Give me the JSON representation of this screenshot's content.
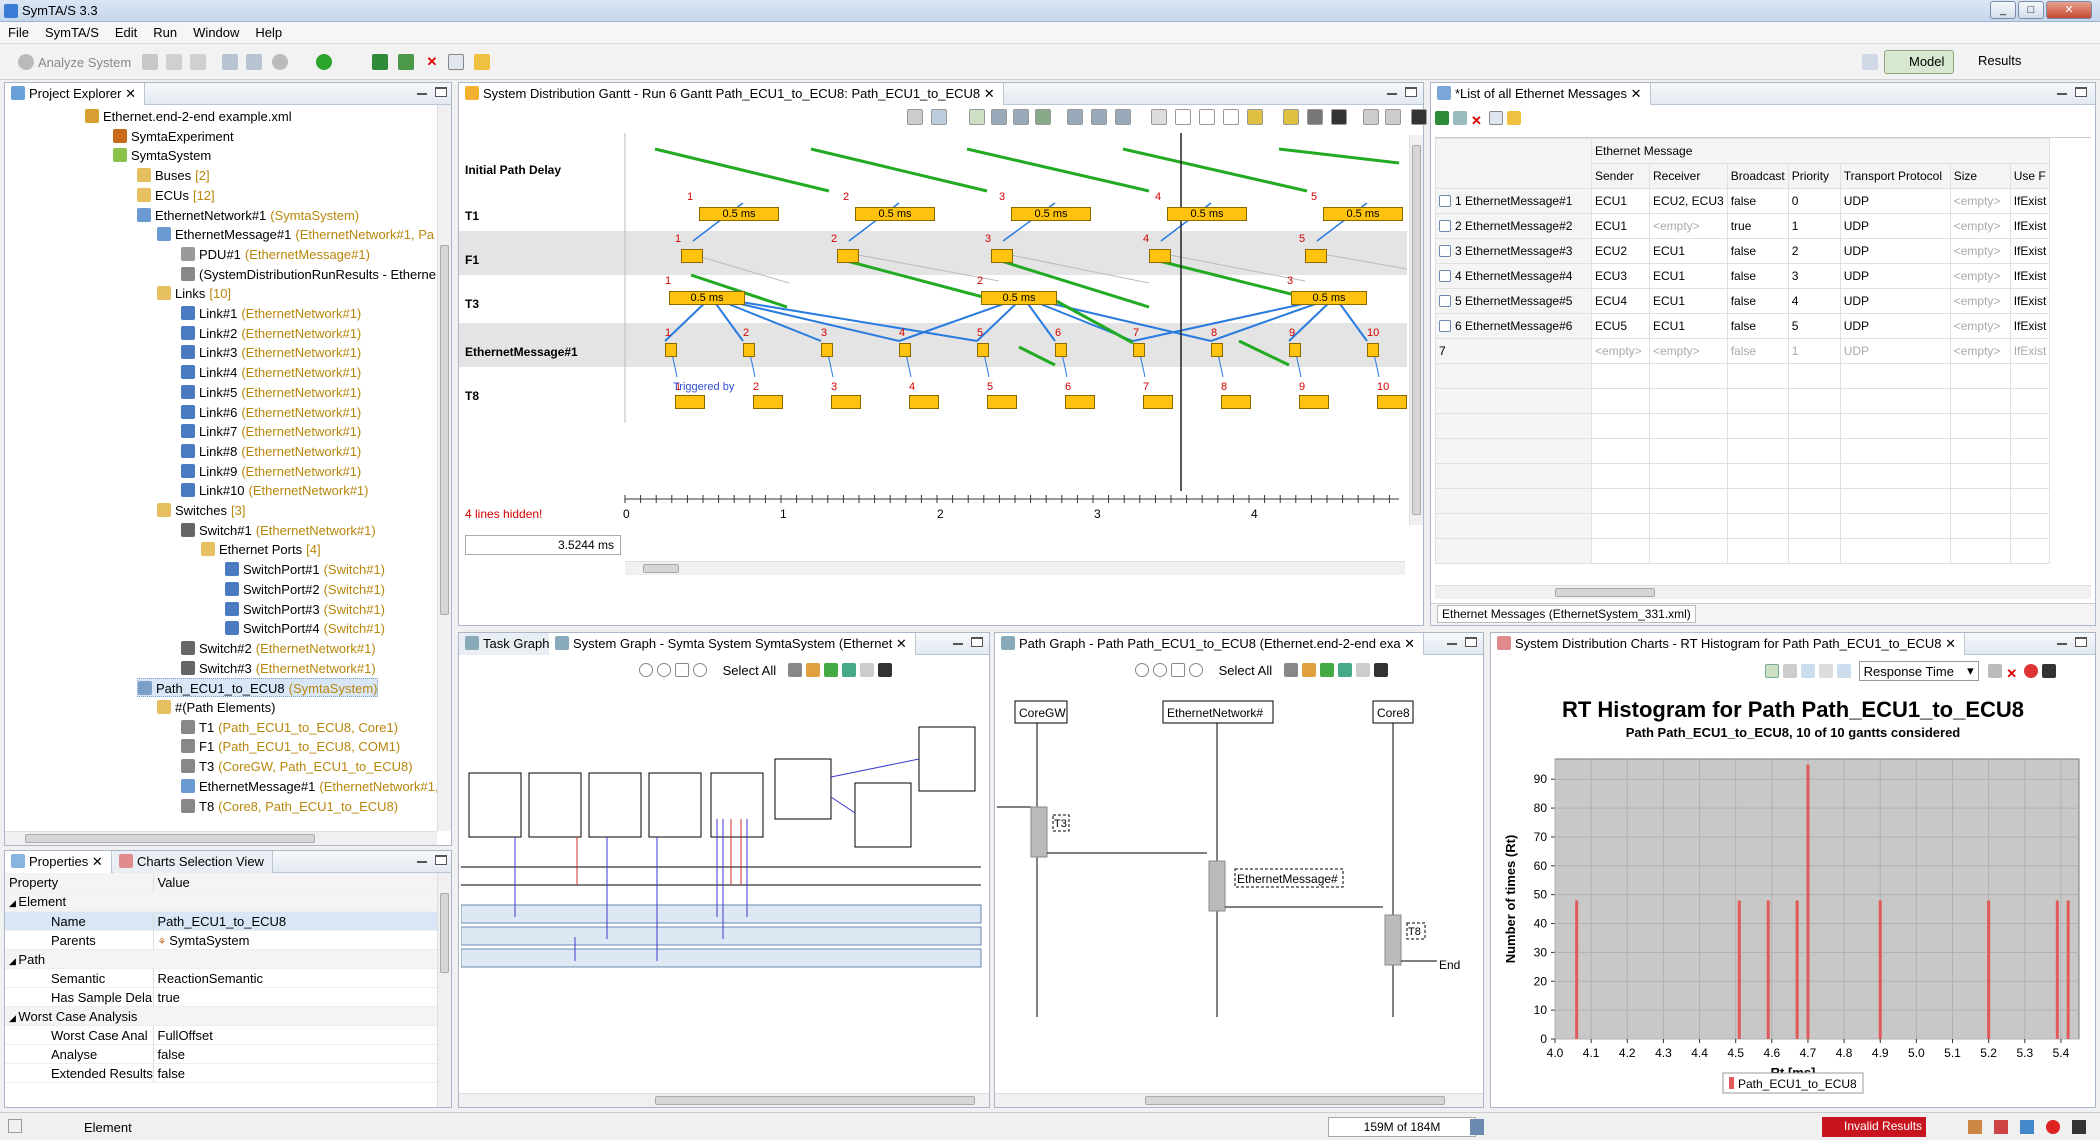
{
  "window": {
    "title": "SymTA/S 3.3"
  },
  "menu": [
    "File",
    "SymTA/S",
    "Edit",
    "Run",
    "Window",
    "Help"
  ],
  "toolbar": {
    "analyze": "Analyze System",
    "model": "Model",
    "results": "Results"
  },
  "project_explorer": {
    "tab": "Project Explorer",
    "items": [
      {
        "label": "Ethernet.end-2-end example.xml",
        "sub": ""
      },
      {
        "label": "SymtaExperiment",
        "sub": ""
      },
      {
        "label": "SymtaSystem",
        "sub": ""
      },
      {
        "label": "Buses",
        "sub": "[2]"
      },
      {
        "label": "ECUs",
        "sub": "[12]"
      },
      {
        "label": "EthernetNetwork#1",
        "sub": "(SymtaSystem)"
      },
      {
        "label": "EthernetMessage#1",
        "sub": "(EthernetNetwork#1, Pa"
      },
      {
        "label": "PDU#1",
        "sub": "(EthernetMessage#1)"
      },
      {
        "label": "(SystemDistributionRunResults - Etherne",
        "sub": ""
      },
      {
        "label": "Links",
        "sub": "[10]"
      },
      {
        "label": "Link#1",
        "sub": "(EthernetNetwork#1)"
      },
      {
        "label": "Link#2",
        "sub": "(EthernetNetwork#1)"
      },
      {
        "label": "Link#3",
        "sub": "(EthernetNetwork#1)"
      },
      {
        "label": "Link#4",
        "sub": "(EthernetNetwork#1)"
      },
      {
        "label": "Link#5",
        "sub": "(EthernetNetwork#1)"
      },
      {
        "label": "Link#6",
        "sub": "(EthernetNetwork#1)"
      },
      {
        "label": "Link#7",
        "sub": "(EthernetNetwork#1)"
      },
      {
        "label": "Link#8",
        "sub": "(EthernetNetwork#1)"
      },
      {
        "label": "Link#9",
        "sub": "(EthernetNetwork#1)"
      },
      {
        "label": "Link#10",
        "sub": "(EthernetNetwork#1)"
      },
      {
        "label": "Switches",
        "sub": "[3]"
      },
      {
        "label": "Switch#1",
        "sub": "(EthernetNetwork#1)"
      },
      {
        "label": "Ethernet Ports",
        "sub": "[4]"
      },
      {
        "label": "SwitchPort#1",
        "sub": "(Switch#1)"
      },
      {
        "label": "SwitchPort#2",
        "sub": "(Switch#1)"
      },
      {
        "label": "SwitchPort#3",
        "sub": "(Switch#1)"
      },
      {
        "label": "SwitchPort#4",
        "sub": "(Switch#1)"
      },
      {
        "label": "Switch#2",
        "sub": "(EthernetNetwork#1)"
      },
      {
        "label": "Switch#3",
        "sub": "(EthernetNetwork#1)"
      },
      {
        "label": "Path_ECU1_to_ECU8",
        "sub": "(SymtaSystem)"
      },
      {
        "label": "#(Path Elements)",
        "sub": ""
      },
      {
        "label": "T1",
        "sub": "(Path_ECU1_to_ECU8, Core1)"
      },
      {
        "label": "F1",
        "sub": "(Path_ECU1_to_ECU8, COM1)"
      },
      {
        "label": "T3",
        "sub": "(CoreGW, Path_ECU1_to_ECU8)"
      },
      {
        "label": "EthernetMessage#1",
        "sub": "(EthernetNetwork#1,"
      },
      {
        "label": "T8",
        "sub": "(Core8, Path_ECU1_to_ECU8)"
      }
    ]
  },
  "properties": {
    "tab": "Properties",
    "tab2": "Charts Selection View",
    "col_property": "Property",
    "col_value": "Value",
    "rows": [
      {
        "cat": "Element"
      },
      {
        "k": "Name",
        "v": "Path_ECU1_to_ECU8"
      },
      {
        "k": "Parents",
        "v": "SymtaSystem"
      },
      {
        "cat": "Path"
      },
      {
        "k": "Semantic",
        "v": "ReactionSemantic"
      },
      {
        "k": "Has Sample Dela",
        "v": "true"
      },
      {
        "cat": "Worst Case Analysis"
      },
      {
        "k": "Worst Case Anal",
        "v": "FullOffset"
      },
      {
        "k": "Analyse",
        "v": "false"
      },
      {
        "k": "Extended Results",
        "v": "false"
      }
    ]
  },
  "gantt": {
    "tab": "System Distribution Gantt - Run 6 Gantt Path_ECU1_to_ECU8: Path_ECU1_to_ECU8",
    "rows": [
      "Initial Path Delay",
      "T1",
      "F1",
      "T3",
      "EthernetMessage#1",
      "T8"
    ],
    "bar_label": "0.5 ms",
    "triggered_label": "Triggered by",
    "hidden_lines": "4 lines hidden!",
    "time_value": "3.5244 ms",
    "axis_ticks": [
      "0",
      "1",
      "2",
      "3",
      "4"
    ]
  },
  "messages": {
    "tab": "*List of all Ethernet Messages",
    "group": "Ethernet Message",
    "columns": [
      "Sender",
      "Receiver",
      "Broadcast",
      "Priority",
      "Transport Protocol",
      "Size",
      "Use F"
    ],
    "rows": [
      {
        "name": "1 EthernetMessage#1",
        "sender": "ECU1",
        "receiver": "ECU2, ECU3",
        "broadcast": "false",
        "priority": "0",
        "proto": "UDP",
        "size": "<empty>",
        "use": "IfExist"
      },
      {
        "name": "2 EthernetMessage#2",
        "sender": "ECU1",
        "receiver": "<empty>",
        "broadcast": "true",
        "priority": "1",
        "proto": "UDP",
        "size": "<empty>",
        "use": "IfExist"
      },
      {
        "name": "3 EthernetMessage#3",
        "sender": "ECU2",
        "receiver": "ECU1",
        "broadcast": "false",
        "priority": "2",
        "proto": "UDP",
        "size": "<empty>",
        "use": "IfExist"
      },
      {
        "name": "4 EthernetMessage#4",
        "sender": "ECU3",
        "receiver": "ECU1",
        "broadcast": "false",
        "priority": "3",
        "proto": "UDP",
        "size": "<empty>",
        "use": "IfExist"
      },
      {
        "name": "5 EthernetMessage#5",
        "sender": "ECU4",
        "receiver": "ECU1",
        "broadcast": "false",
        "priority": "4",
        "proto": "UDP",
        "size": "<empty>",
        "use": "IfExist"
      },
      {
        "name": "6 EthernetMessage#6",
        "sender": "ECU5",
        "receiver": "ECU1",
        "broadcast": "false",
        "priority": "5",
        "proto": "UDP",
        "size": "<empty>",
        "use": "IfExist"
      },
      {
        "name": "7",
        "sender": "<empty>",
        "receiver": "<empty>",
        "broadcast": "false",
        "priority": "1",
        "proto": "UDP",
        "size": "<empty>",
        "use": "IfExist"
      }
    ],
    "footer": "Ethernet Messages (EthernetSystem_331.xml)"
  },
  "task_graph": {
    "tab1": "Task Graph",
    "tab2": "System Graph - Symta System SymtaSystem (Ethernet",
    "select_all": "Select All"
  },
  "path_graph": {
    "tab": "Path Graph - Path Path_ECU1_to_ECU8 (Ethernet.end-2-end exa",
    "select_all": "Select All",
    "nodes": [
      "CoreGW",
      "EthernetNetwork#",
      "Core8"
    ],
    "boxes": [
      "T3",
      "EthernetMessage#",
      "T8"
    ],
    "end": "End"
  },
  "charts": {
    "tab": "System Distribution Charts - RT Histogram for Path Path_ECU1_to_ECU8",
    "response": "Response Time",
    "chart_data": {
      "type": "bar",
      "title": "RT Histogram for Path Path_ECU1_to_ECU8",
      "subtitle": "Path Path_ECU1_to_ECU8, 10 of 10 gantts considered",
      "xlabel": "Rt [ms]",
      "ylabel": "Number of times (Rt)",
      "xlim": [
        4.0,
        5.45
      ],
      "ylim": [
        0,
        97
      ],
      "xticks": [
        "4.0",
        "4.1",
        "4.2",
        "4.3",
        "4.4",
        "4.5",
        "4.6",
        "4.7",
        "4.8",
        "4.9",
        "5.0",
        "5.1",
        "5.2",
        "5.3",
        "5.4"
      ],
      "yticks": [
        "0",
        "10",
        "20",
        "30",
        "40",
        "50",
        "60",
        "70",
        "80",
        "90"
      ],
      "series": [
        {
          "name": "Path_ECU1_to_ECU8",
          "x": [
            4.06,
            4.51,
            4.59,
            4.67,
            4.7,
            4.9,
            5.2,
            5.39,
            5.42
          ],
          "values": [
            48,
            48,
            48,
            48,
            95,
            48,
            48,
            48,
            48
          ]
        }
      ]
    }
  },
  "status": {
    "left": "Element",
    "memory": "159M of 184M",
    "invalid": "Invalid Results"
  },
  "colors": {
    "accent": "#ffc20e",
    "green": "#22aa22",
    "blue": "#2a7be0",
    "red": "#d40000"
  }
}
